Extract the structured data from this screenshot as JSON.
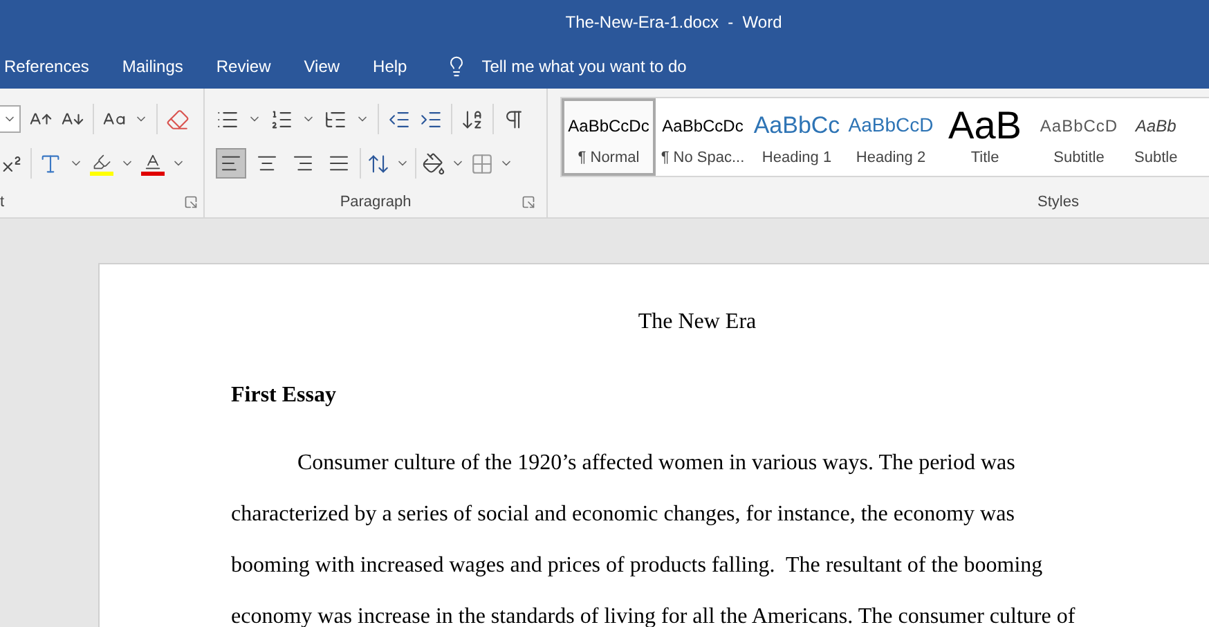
{
  "window": {
    "title": "The-New-Era-1.docx  -  Word"
  },
  "tabs": [
    {
      "label": "References"
    },
    {
      "label": "Mailings"
    },
    {
      "label": "Review"
    },
    {
      "label": "View"
    },
    {
      "label": "Help"
    }
  ],
  "tell_me": {
    "placeholder": "Tell me what you want to do"
  },
  "ribbon": {
    "font_group": {
      "label": "t"
    },
    "paragraph_group": {
      "label": "Paragraph",
      "alignments": [
        {
          "kind": "left",
          "selected": true
        },
        {
          "kind": "center",
          "selected": false
        },
        {
          "kind": "right",
          "selected": false
        },
        {
          "kind": "justify",
          "selected": false
        }
      ]
    },
    "styles_group": {
      "label": "Styles",
      "items": [
        {
          "kind": "normal",
          "sample": "AaBbCcDc",
          "label": "¶ Normal",
          "selected": true
        },
        {
          "kind": "normal",
          "sample": "AaBbCcDc",
          "label": "¶ No Spac...",
          "selected": false
        },
        {
          "kind": "heading1",
          "sample": "AaBbCc",
          "label": "Heading 1",
          "selected": false
        },
        {
          "kind": "heading2",
          "sample": "AaBbCcD",
          "label": "Heading 2",
          "selected": false
        },
        {
          "kind": "title",
          "sample": "AaB",
          "label": "Title",
          "selected": false
        },
        {
          "kind": "subtitle",
          "sample": "AaBbCcD",
          "label": "Subtitle",
          "selected": false
        },
        {
          "kind": "emphasis",
          "sample": "AaBb",
          "label": "Subtle",
          "selected": false
        }
      ]
    }
  },
  "document": {
    "title": "The New Era",
    "heading": "First Essay",
    "paragraph": "Consumer culture of the 1920’s affected women in various ways. The period was characterized by a series of social and economic changes, for instance, the economy was booming with increased wages and prices of products falling.  The resultant of the booming economy was increase in the standards of living for all the Americans. The consumer culture of"
  }
}
